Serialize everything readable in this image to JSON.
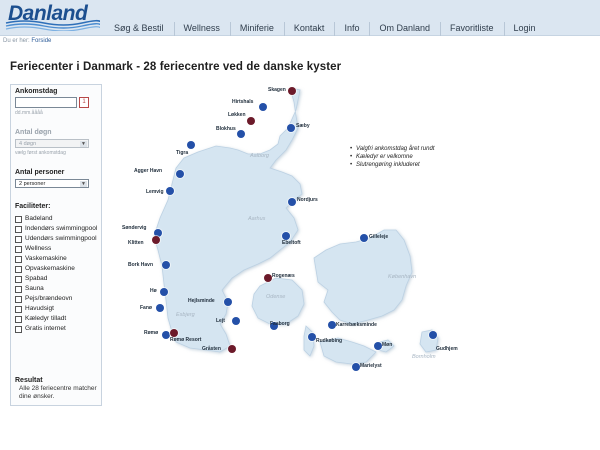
{
  "header": {
    "logo": "Danland",
    "nav": [
      "Søg & Bestil",
      "Wellness",
      "Miniferie",
      "Kontakt",
      "Info",
      "Om Danland",
      "Favoritliste",
      "Login"
    ]
  },
  "breadcrumb": {
    "prefix": "Du er her:",
    "current": "Forside"
  },
  "page_title": "Feriecenter i Danmark - 28 feriecentre ved de danske kyster",
  "sidebar": {
    "arrival_label": "Ankomstdag",
    "date_placeholder": "dd.mm.åååå",
    "calendar_glyph": "1",
    "days_label": "Antal døgn",
    "days_value": "4 døgn",
    "days_hint": "vælg først ankomstdag",
    "persons_label": "Antal personer",
    "persons_value": "2 personer",
    "facilities_label": "Faciliteter:",
    "facilities": [
      "Badeland",
      "Indendørs swimmingpool",
      "Udendørs swimmingpool",
      "Wellness",
      "Vaskemaskine",
      "Opvaskemaskine",
      "Spabad",
      "Sauna",
      "Pejs/brændeovn",
      "Havudsigt",
      "Kæledyr tilladt",
      "Gratis internet"
    ],
    "result_label": "Resultat",
    "result_text": "Alle 28 feriecentre matcher dine ønsker."
  },
  "map": {
    "regions": [
      {
        "name": "Aalborg"
      },
      {
        "name": "Aarhus"
      },
      {
        "name": "Esbjerg"
      },
      {
        "name": "Odense"
      },
      {
        "name": "København"
      },
      {
        "name": "Bornholm"
      }
    ],
    "centers": [
      {
        "name": "Skagen",
        "color": "red"
      },
      {
        "name": "Hirtshals",
        "color": "blue"
      },
      {
        "name": "Løkken",
        "color": "red"
      },
      {
        "name": "Blokhus",
        "color": "blue"
      },
      {
        "name": "Sæby",
        "color": "blue"
      },
      {
        "name": "Tigra",
        "color": "blue"
      },
      {
        "name": "Agger Havn",
        "color": "blue"
      },
      {
        "name": "Lemvig",
        "color": "blue"
      },
      {
        "name": "Nordjurs",
        "color": "blue"
      },
      {
        "name": "Søndervig",
        "color": "blue"
      },
      {
        "name": "Klitten",
        "color": "red"
      },
      {
        "name": "Ebeltoft",
        "color": "blue"
      },
      {
        "name": "Gilleleje",
        "color": "blue"
      },
      {
        "name": "Bork Havn",
        "color": "blue"
      },
      {
        "name": "Rogenæs",
        "color": "red"
      },
      {
        "name": "Hø",
        "color": "blue"
      },
      {
        "name": "Fanø",
        "color": "blue"
      },
      {
        "name": "Hejlsminde",
        "color": "blue"
      },
      {
        "name": "Lejt",
        "color": "blue"
      },
      {
        "name": "Faaborg",
        "color": "blue"
      },
      {
        "name": "Karrebæksminde",
        "color": "blue"
      },
      {
        "name": "Rømø",
        "color": "blue"
      },
      {
        "name": "Rømø Resort",
        "color": "red"
      },
      {
        "name": "Rudkøbing",
        "color": "blue"
      },
      {
        "name": "Møn",
        "color": "blue"
      },
      {
        "name": "Gråsten",
        "color": "red"
      },
      {
        "name": "Marielyst",
        "color": "blue"
      },
      {
        "name": "Gudhjem",
        "color": "blue"
      }
    ]
  },
  "bullets": [
    "Valgfri ankomstdag året rundt",
    "Kæledyr er velkomne",
    "Slutrengøring inkluderet"
  ],
  "colors": {
    "header_bg": "#dbe6f1",
    "blue_dot": "#2450a8",
    "red_dot": "#6c1a2a",
    "land": "#d5e5f1",
    "logo": "#1c4f8f"
  }
}
